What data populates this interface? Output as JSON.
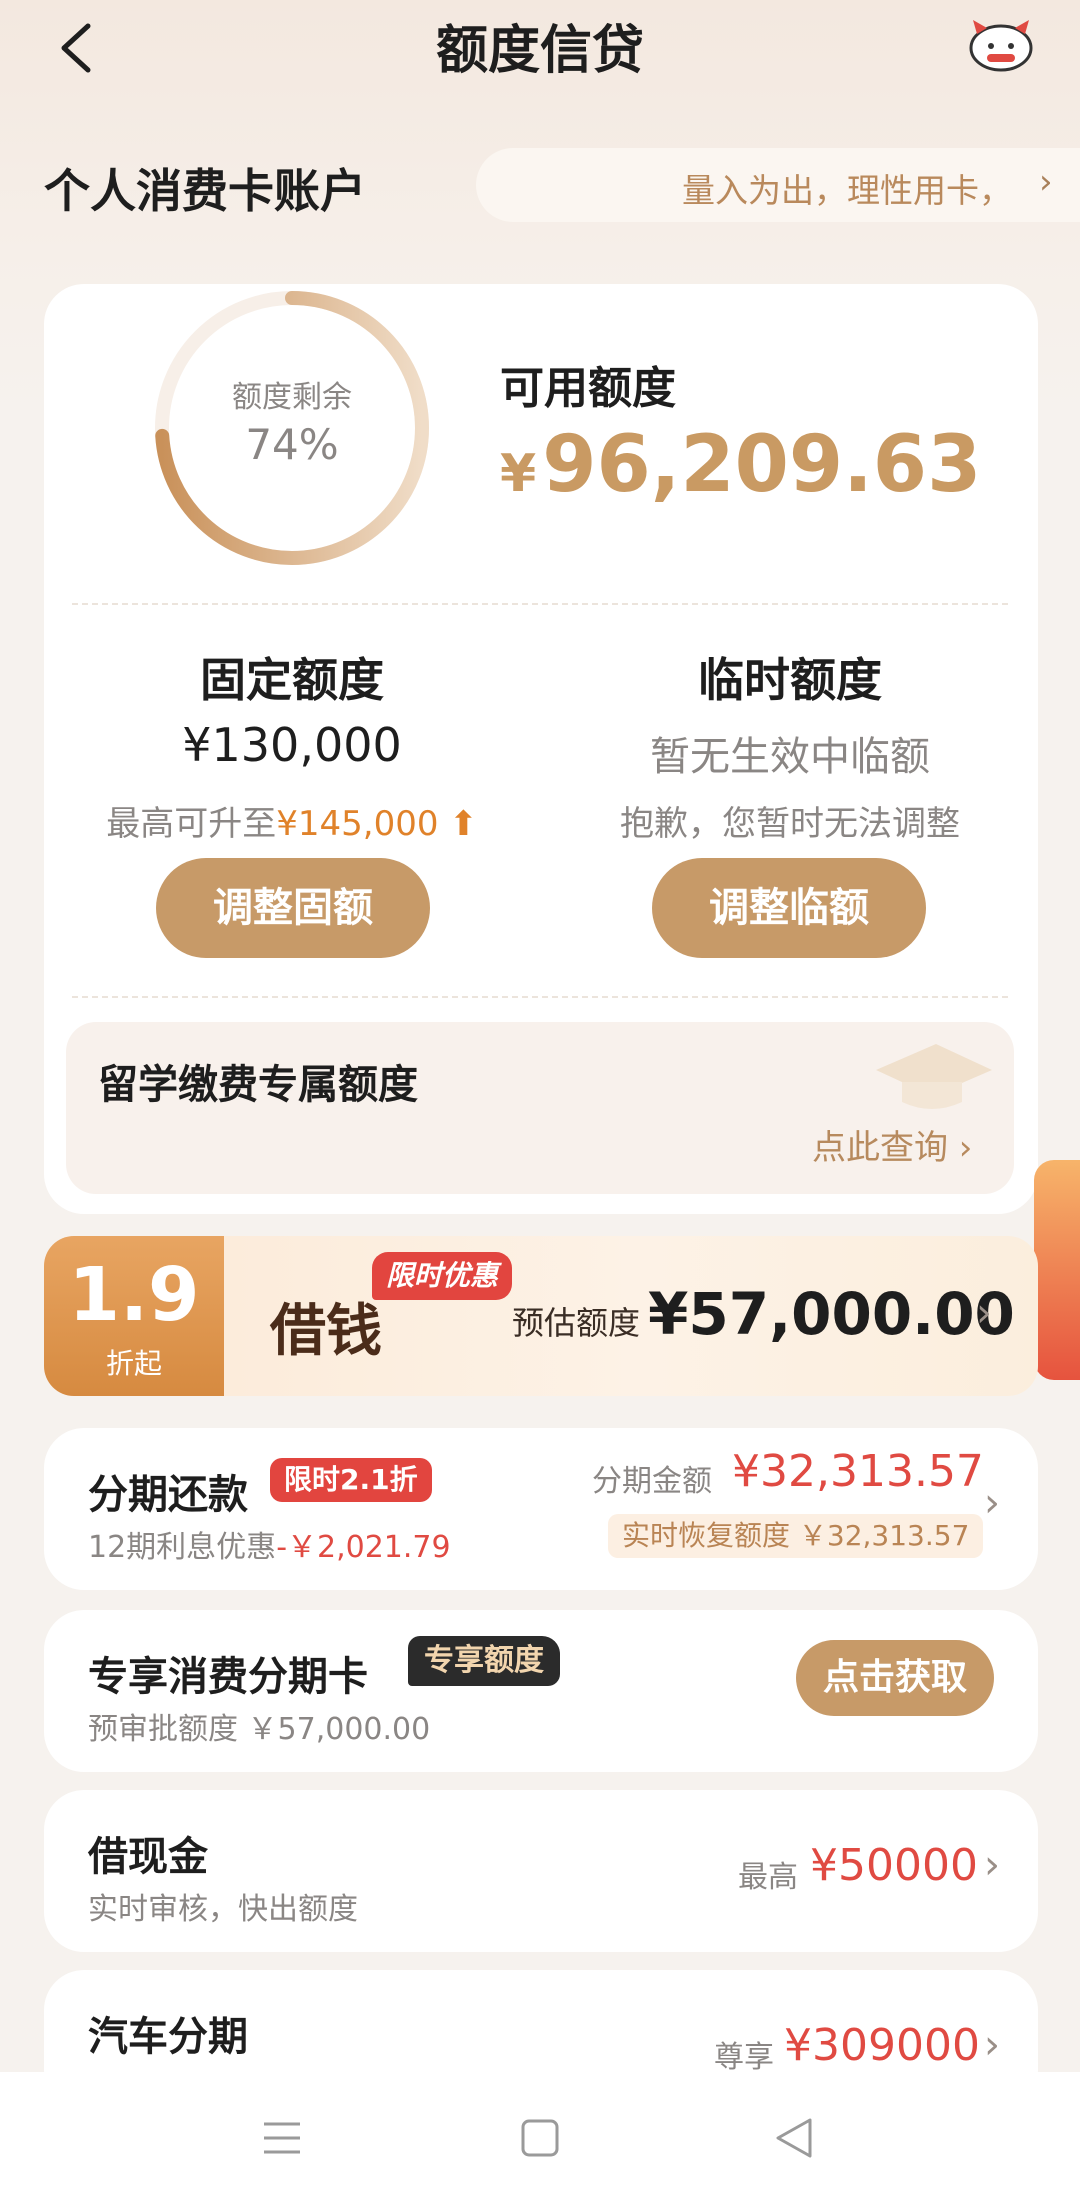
{
  "header": {
    "title": "额度信贷"
  },
  "account": {
    "title": "个人消费卡账户",
    "tip": "量入为出，理性用卡，",
    "tip_chevron": "›"
  },
  "credit": {
    "ring_label": "额度剩余",
    "ring_percent": "74%",
    "ring_fraction": 0.74,
    "available_label": "可用额度",
    "available_currency": "¥",
    "available_amount": "96,209.63"
  },
  "fixed": {
    "title": "固定额度",
    "amount": "¥130,000",
    "upgrade_prefix": "最高可升至",
    "upgrade_amount": "¥145,000",
    "button": "调整固额"
  },
  "temp": {
    "title": "临时额度",
    "status": "暂无生效中临额",
    "note": "抱歉，您暂时无法调整",
    "button": "调整临额"
  },
  "study": {
    "title": "留学缴费专属额度",
    "link": "点此查询 ›"
  },
  "loan": {
    "rate": "1.9",
    "rate_suffix": "折起",
    "title": "借钱",
    "tag": "限时优惠",
    "est_label": "预估额度",
    "est_amount": "¥57,000.00",
    "chevron": "›"
  },
  "installment": {
    "title": "分期还款",
    "tag": "限时2.1折",
    "sub_prefix": "12期利息优惠",
    "sub_amount": "-￥2,021.79",
    "amount_label": "分期金额",
    "amount": "¥32,313.57",
    "restore": "实时恢复额度 ￥32,313.57",
    "chevron": "›"
  },
  "card": {
    "title": "专享消费分期卡",
    "tag": "专享额度",
    "sub": "预审批额度 ￥57,000.00",
    "button": "点击获取"
  },
  "cash": {
    "title": "借现金",
    "sub": "实时审核，快出额度",
    "label": "最高",
    "amount": "¥50000",
    "chevron": "›"
  },
  "car": {
    "title": "汽车分期",
    "label": "尊享",
    "amount": "¥309000",
    "chevron": "›"
  },
  "colors": {
    "accent": "#c99a63",
    "red": "#e04a42",
    "orange": "#e0822a"
  },
  "icons": [
    "back-icon",
    "mascot-icon",
    "graduation-cap-icon",
    "menu-icon",
    "home-icon",
    "back-triangle-icon"
  ]
}
